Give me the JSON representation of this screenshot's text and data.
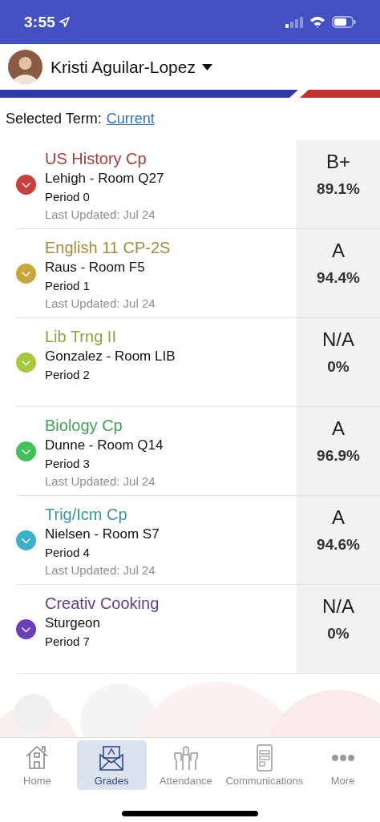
{
  "status_bar": {
    "time": "3:55"
  },
  "header": {
    "student_name": "Kristi Aguilar-Lopez"
  },
  "term": {
    "label": "Selected Term:",
    "value": "Current"
  },
  "courses": [
    {
      "name": "US History Cp",
      "teacher_room": "Lehigh - Room Q27",
      "period": "Period 0",
      "last_updated": "Last Updated: Jul 24",
      "grade": "B+",
      "percent": "89.1%",
      "color": "#c8403f"
    },
    {
      "name": "English 11 CP-2S",
      "teacher_room": "Raus - Room F5",
      "period": "Period 1",
      "last_updated": "Last Updated: Jul 24",
      "grade": "A",
      "percent": "94.4%",
      "color": "#c9a63a"
    },
    {
      "name": "Lib Trng II",
      "teacher_room": "Gonzalez - Room LIB",
      "period": "Period 2",
      "grade": "N/A",
      "percent": "0%",
      "color": "#a6c93c"
    },
    {
      "name": "Biology Cp",
      "teacher_room": "Dunne - Room Q14",
      "period": "Period 3",
      "last_updated": "Last Updated: Jul 24",
      "grade": "A",
      "percent": "96.9%",
      "color": "#3fc25a"
    },
    {
      "name": "Trig/Icm Cp",
      "teacher_room": "Nielsen - Room S7",
      "period": "Period 4",
      "last_updated": "Last Updated: Jul 24",
      "grade": "A",
      "percent": "94.6%",
      "color": "#3db0c6"
    },
    {
      "name": "Creativ Cooking",
      "teacher_room": "Sturgeon",
      "period": "Period 7",
      "grade": "N/A",
      "percent": "0%",
      "color": "#6b3fb8"
    }
  ],
  "tab_bar": [
    {
      "label": "Home",
      "kind": "home",
      "selected": false
    },
    {
      "label": "Grades",
      "kind": "grades",
      "selected": true
    },
    {
      "label": "Attendance",
      "kind": "attendance",
      "selected": false
    },
    {
      "label": "Communications",
      "kind": "communications",
      "selected": false
    },
    {
      "label": "More",
      "kind": "more",
      "selected": false
    }
  ]
}
